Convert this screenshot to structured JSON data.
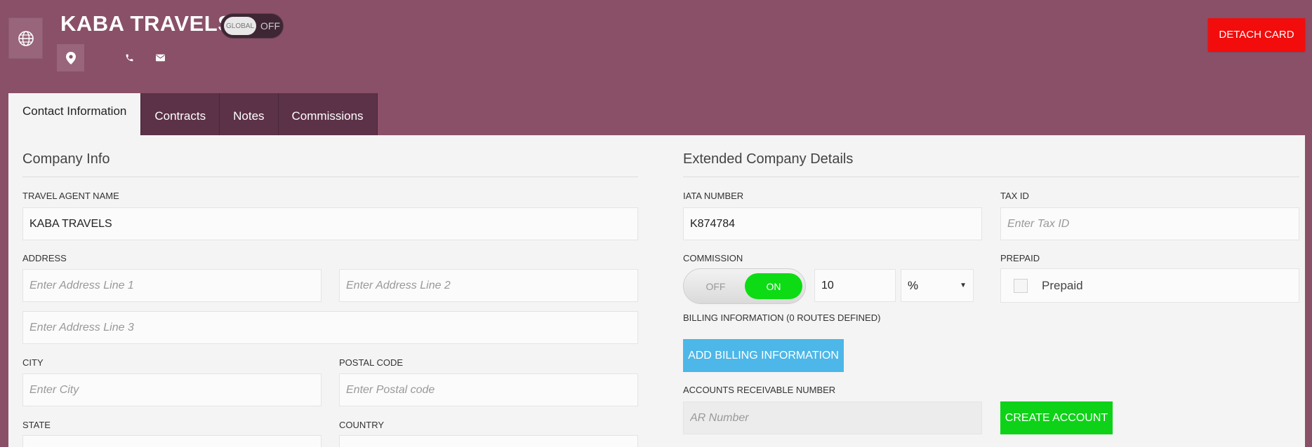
{
  "header": {
    "company_name": "KABA TRAVELS",
    "global_toggle_label": "GLOBAL",
    "global_toggle_state": "OFF",
    "detach_label": "DETACH CARD",
    "icons": [
      "globe-icon",
      "map-pin-icon",
      "phone-icon",
      "mail-icon"
    ]
  },
  "tabs": [
    {
      "label": "Contact Information",
      "active": true
    },
    {
      "label": "Contracts",
      "active": false
    },
    {
      "label": "Notes",
      "active": false
    },
    {
      "label": "Commissions",
      "active": false
    }
  ],
  "company_info": {
    "title": "Company Info",
    "travel_agent_name_label": "TRAVEL AGENT NAME",
    "travel_agent_name_value": "KABA TRAVELS",
    "address_label": "ADDRESS",
    "address1_placeholder": "Enter Address Line 1",
    "address2_placeholder": "Enter Address Line 2",
    "address3_placeholder": "Enter Address Line 3",
    "city_label": "CITY",
    "city_placeholder": "Enter City",
    "postal_label": "POSTAL CODE",
    "postal_placeholder": "Enter Postal code",
    "state_label": "STATE",
    "country_label": "COUNTRY"
  },
  "extended": {
    "title": "Extended Company Details",
    "iata_label": "IATA NUMBER",
    "iata_value": "K874784",
    "tax_label": "TAX ID",
    "tax_placeholder": "Enter Tax ID",
    "commission_label": "COMMISSION",
    "commission_off": "OFF",
    "commission_on": "ON",
    "commission_value": "10",
    "commission_unit": "%",
    "prepaid_label": "PREPAID",
    "prepaid_checkbox_label": "Prepaid",
    "billing_label": "BILLING INFORMATION (0 ROUTES DEFINED)",
    "billing_button": "ADD BILLING INFORMATION",
    "ar_label": "ACCOUNTS RECEIVABLE NUMBER",
    "ar_placeholder": "AR Number",
    "create_account_button": "CREATE ACCOUNT"
  },
  "colors": {
    "background": "#8a5068",
    "detach": "#f20c0c",
    "toggle_on": "#0ddc14",
    "billing_button": "#4cb7e8",
    "create_button": "#0ed217"
  }
}
